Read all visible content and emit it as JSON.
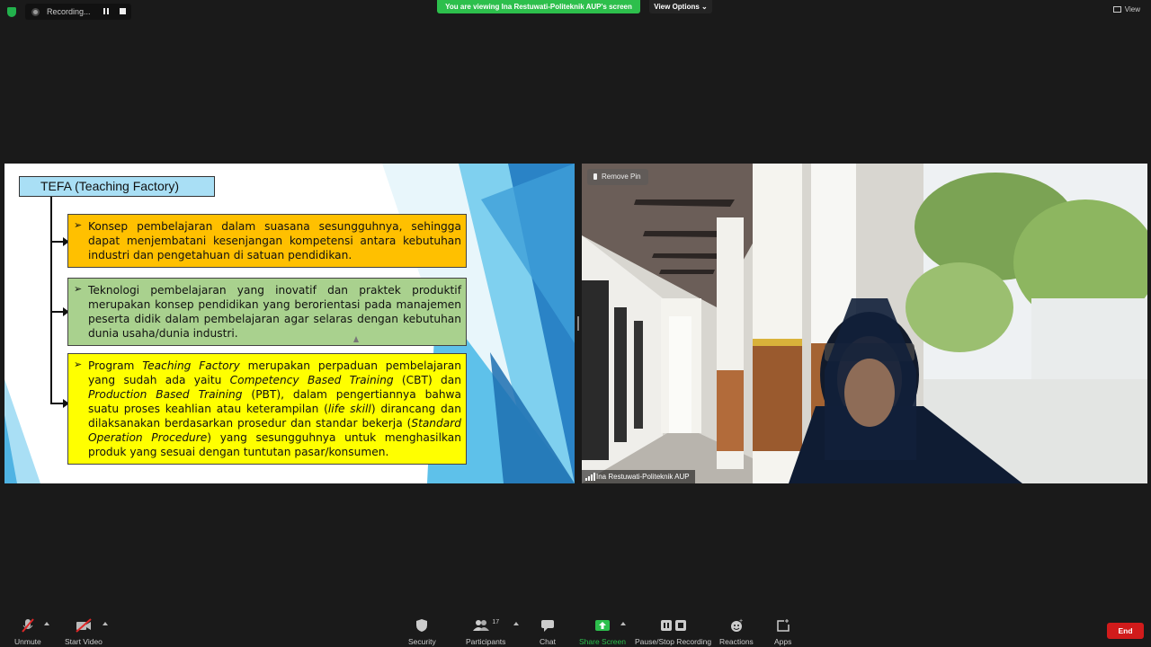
{
  "recording": {
    "label": "Recording..."
  },
  "banner": {
    "viewing": "You are viewing Ina Restuwati-Politeknik AUP's screen",
    "view_options": "View Options",
    "view": "View"
  },
  "slide": {
    "title": "TEFA (Teaching Factory)",
    "box1": "Konsep pembelajaran dalam suasana sesungguhnya, sehingga dapat menjembatani kesenjangan kompetensi antara kebutuhan industri dan pengetahuan di satuan pendidikan.",
    "box2": "Teknologi pembelajaran yang inovatif dan praktek produktif merupakan konsep pendidikan yang berorientasi pada manajemen peserta didik dalam pembelajaran agar selaras dengan kebutuhan dunia usaha/dunia industri.",
    "box3_parts": {
      "p1": "Program ",
      "i1": "Teaching Factory",
      "p2": " merupakan perpaduan pembelajaran yang sudah ada yaitu ",
      "i2": "Competency Based Training",
      "p3": " (CBT) dan ",
      "i3": "Production Based Training",
      "p4": " (PBT), dalam pengertiannya bahwa suatu proses keahlian atau keterampilan (",
      "i4": "life skill",
      "p5": ") dirancang dan dilaksanakan berdasarkan prosedur dan standar bekerja (",
      "i5": "Standard Operation Procedure",
      "p6": ") yang sesungguhnya untuk menghasilkan produk yang sesuai dengan tuntutan pasar/konsumen."
    }
  },
  "video": {
    "remove_pin": "Remove Pin",
    "participant_name": "Ina Restuwati-Politeknik AUP"
  },
  "toolbar": {
    "unmute": "Unmute",
    "start_video": "Start Video",
    "security": "Security",
    "participants": "Participants",
    "participants_count": "17",
    "chat": "Chat",
    "share_screen": "Share Screen",
    "pause_recording": "Pause/Stop Recording",
    "reactions": "Reactions",
    "apps": "Apps",
    "end": "End"
  },
  "colors": {
    "share_green": "#2dbf4c",
    "end_red": "#d11b1b",
    "box1": "#ffc000",
    "box2": "#a9d18e",
    "box3": "#ffff00",
    "title_bg": "#a9dff5"
  }
}
